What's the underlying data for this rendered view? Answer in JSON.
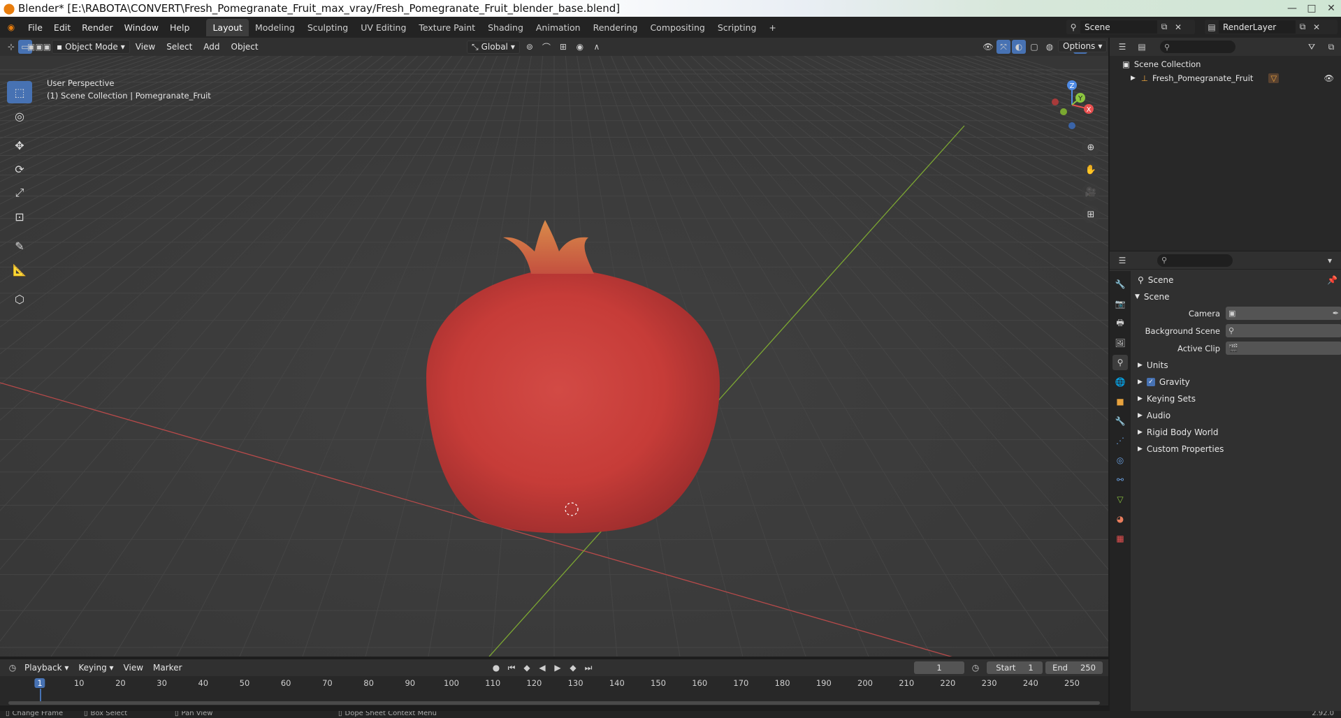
{
  "window": {
    "title": "Blender* [E:\\RABOTA\\CONVERT\\Fresh_Pomegranate_Fruit_max_vray/Fresh_Pomegranate_Fruit_blender_base.blend]",
    "minimize": "—",
    "maximize": "□",
    "close": "✕"
  },
  "menu": [
    "File",
    "Edit",
    "Render",
    "Window",
    "Help"
  ],
  "workspaces": [
    "Layout",
    "Modeling",
    "Sculpting",
    "UV Editing",
    "Texture Paint",
    "Shading",
    "Animation",
    "Rendering",
    "Compositing",
    "Scripting"
  ],
  "active_workspace": "Layout",
  "scene_field": "Scene",
  "renderlayer_field": "RenderLayer",
  "viewport_header": {
    "mode": "Object Mode",
    "items": [
      "View",
      "Select",
      "Add",
      "Object"
    ],
    "orientation": "Global",
    "options": "Options"
  },
  "viewport": {
    "perspective_label": "User Perspective",
    "collection_label": "(1) Scene Collection | Pomegranate_Fruit",
    "gizmo": {
      "x": "X",
      "y": "Y",
      "z": "Z"
    }
  },
  "outliner": {
    "root": "Scene Collection",
    "items": [
      {
        "label": "Fresh_Pomegranate_Fruit"
      }
    ]
  },
  "properties": {
    "context": "Scene",
    "panel": "Scene",
    "fields": [
      {
        "label": "Camera",
        "value": ""
      },
      {
        "label": "Background Scene",
        "value": ""
      },
      {
        "label": "Active Clip",
        "value": ""
      }
    ],
    "subpanels": [
      "Units",
      "Gravity",
      "Keying Sets",
      "Audio",
      "Rigid Body World",
      "Custom Properties"
    ],
    "gravity_checked": true
  },
  "timeline": {
    "menus": [
      "Playback",
      "Keying",
      "View",
      "Marker"
    ],
    "current_frame": "1",
    "start_label": "Start",
    "start": "1",
    "end_label": "End",
    "end": "250",
    "ticks": [
      "1",
      "10",
      "20",
      "30",
      "40",
      "50",
      "60",
      "70",
      "80",
      "90",
      "100",
      "110",
      "120",
      "130",
      "140",
      "150",
      "160",
      "170",
      "180",
      "190",
      "200",
      "210",
      "220",
      "230",
      "240",
      "250"
    ]
  },
  "statusbar": {
    "items": [
      "Change Frame",
      "Box Select",
      "Pan View",
      "Dope Sheet Context Menu"
    ],
    "version": "2.92.0"
  },
  "colors": {
    "accent": "#4772b3",
    "viewport_bg": "#3a3a3a",
    "x_axis": "#b84a4a",
    "y_axis": "#7da832",
    "fruit": "#c9403b"
  }
}
